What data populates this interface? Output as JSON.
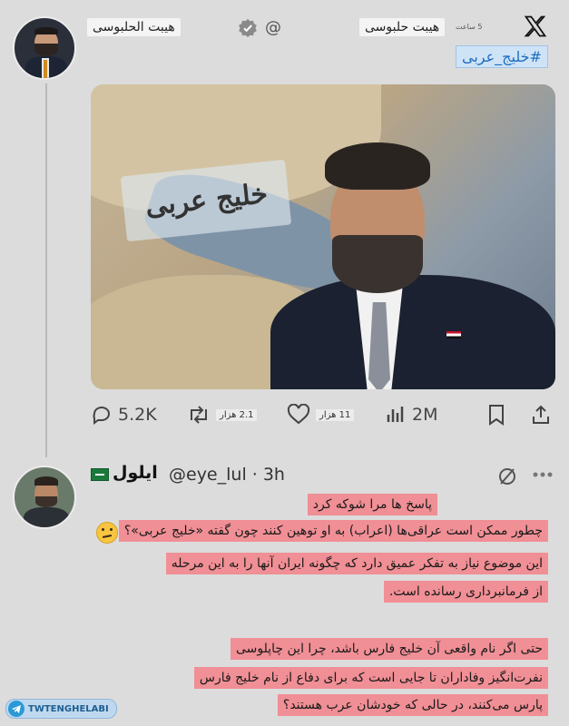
{
  "tweet": {
    "author_display_name": "هيبت الحلبوسی",
    "handle_at": "@",
    "time_unit": "5 ساعت",
    "header_name": "هیبت حلبوسی",
    "hashtag": "#خلیج_عربی",
    "media_caption": "خلیج عربی",
    "icons": {
      "logo": "x-logo-icon",
      "verified": "verified-badge-icon",
      "reply": "reply-icon",
      "retweet": "retweet-icon",
      "like": "heart-icon",
      "views": "views-icon",
      "bookmark": "bookmark-icon",
      "share": "share-icon"
    },
    "stats": {
      "replies": "5.2K",
      "retweets_label": "2.1 هزار",
      "likes_label": "11 هزار",
      "views": "2M"
    }
  },
  "reply": {
    "display_name": "ایلول",
    "handle_time": "@eye_lul · 3h",
    "lines": [
      "پاسخ ها مرا شوکه کرد",
      "چطور ممکن است عراقی‌ها (اعراب) به او توهین کنند چون گفته «خلیج عربی»؟",
      "این موضوع نیاز به تفکر عمیق دارد که چگونه ایران آنها را به این مرحله",
      "از فرمانبرداری رسانده است.",
      "حتی اگر نام واقعی آن خلیج فارس باشد، چرا این چاپلوسی",
      "نفرت‌انگیز وفاداران تا جایی است که برای دفاع از نام خلیج فارس",
      "پارس می‌کنند، در حالی که خودشان عرب هستند؟"
    ],
    "flag_colors": [
      "#1a7a3c",
      "#ffffff"
    ],
    "icons": {
      "mute": "mute-icon",
      "more": "more-icon",
      "emoji": "thinking-face-icon"
    }
  },
  "watermark": {
    "label": "TWTENGHELABI",
    "icon": "telegram-icon"
  },
  "colors": {
    "highlight": "#f08f95",
    "background": "#dcdcdc",
    "hashtag_bg": "#cfe3f7",
    "hashtag_text": "#1d6fbf"
  }
}
